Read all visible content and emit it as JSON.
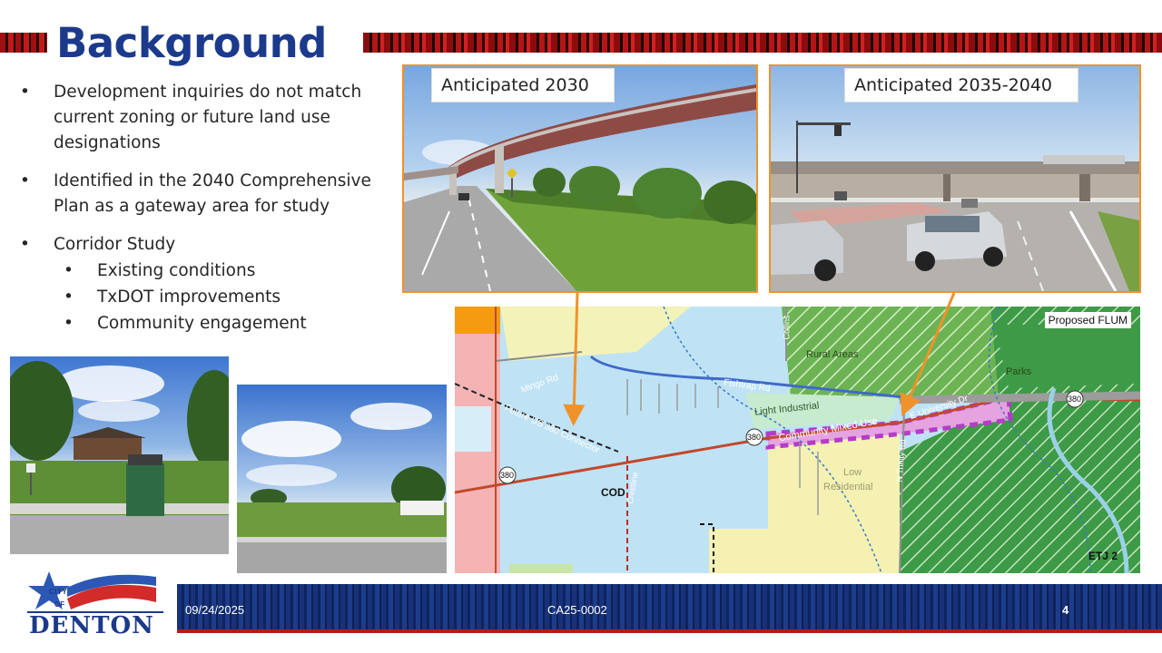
{
  "slide": {
    "title": "Background",
    "bullets": [
      {
        "text": "Development inquiries do not match current zoning or future land use designations"
      },
      {
        "text": "Identified in the 2040 Comprehensive Plan as a gateway area for study"
      },
      {
        "text": "Corridor Study",
        "sub": [
          "Existing conditions",
          "TxDOT improvements",
          "Community engagement"
        ]
      }
    ]
  },
  "photos": {
    "label_2030": "Anticipated 2030",
    "label_2035": "Anticipated 2035-2040"
  },
  "map": {
    "title": "Proposed FLUM",
    "labels": {
      "rural": "Rural Areas",
      "parks": "Parks",
      "light_industrial": "Light Industrial",
      "community_mixed_use": "Community Mixed Use",
      "low_residential_1": "Low",
      "low_residential_2": "Residential",
      "cod": "COD",
      "etj": "ETJ 2",
      "mingo": "Mingo Rd",
      "fishtrap": "Fishtrap Rd",
      "university": "E University Dr",
      "future_connector": "Future US 380 Connector",
      "crestline": "Crestline",
      "n_trinity": "N Trinity Rd",
      "collins": "Collins",
      "hwy_380": "380"
    }
  },
  "footer": {
    "date": "09/24/2025",
    "case": "CA25-0002",
    "page": "4"
  },
  "logo": {
    "city": "CITY",
    "of": "OF",
    "name": "DENTON"
  },
  "colors": {
    "title_blue": "#1b3a8c",
    "accent_orange": "#f0922b",
    "banner_red": "#b31b1b",
    "mixed_use_magenta": "#b43cc8"
  }
}
